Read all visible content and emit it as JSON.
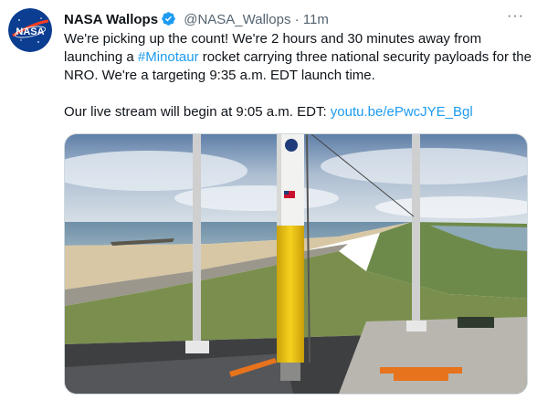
{
  "author": {
    "avatar_text": "NASA",
    "name": "NASA Wallops",
    "handle": "@NASA_Wallops",
    "separator": "·",
    "time": "11m"
  },
  "more_label": "···",
  "tweet": {
    "p1_a": "We're picking up the count! We're 2 hours and 30 minutes away from launching a ",
    "hashtag": "#Minotaur",
    "p1_b": " rocket carrying three national security payloads for the NRO. We're a targeting 9:35 a.m. EDT launch time.",
    "p2_a": "Our live stream will begin at 9:05 a.m. EDT: ",
    "link": "youtu.be/ePwcJYE_Bgl"
  },
  "colors": {
    "link": "#1d9bf0",
    "verified": "#1d9bf0",
    "muted": "#536471",
    "rocket_body": "#f3cc1c"
  },
  "icons": [
    "nasa-logo-icon",
    "verified-badge-icon",
    "more-options-icon"
  ]
}
